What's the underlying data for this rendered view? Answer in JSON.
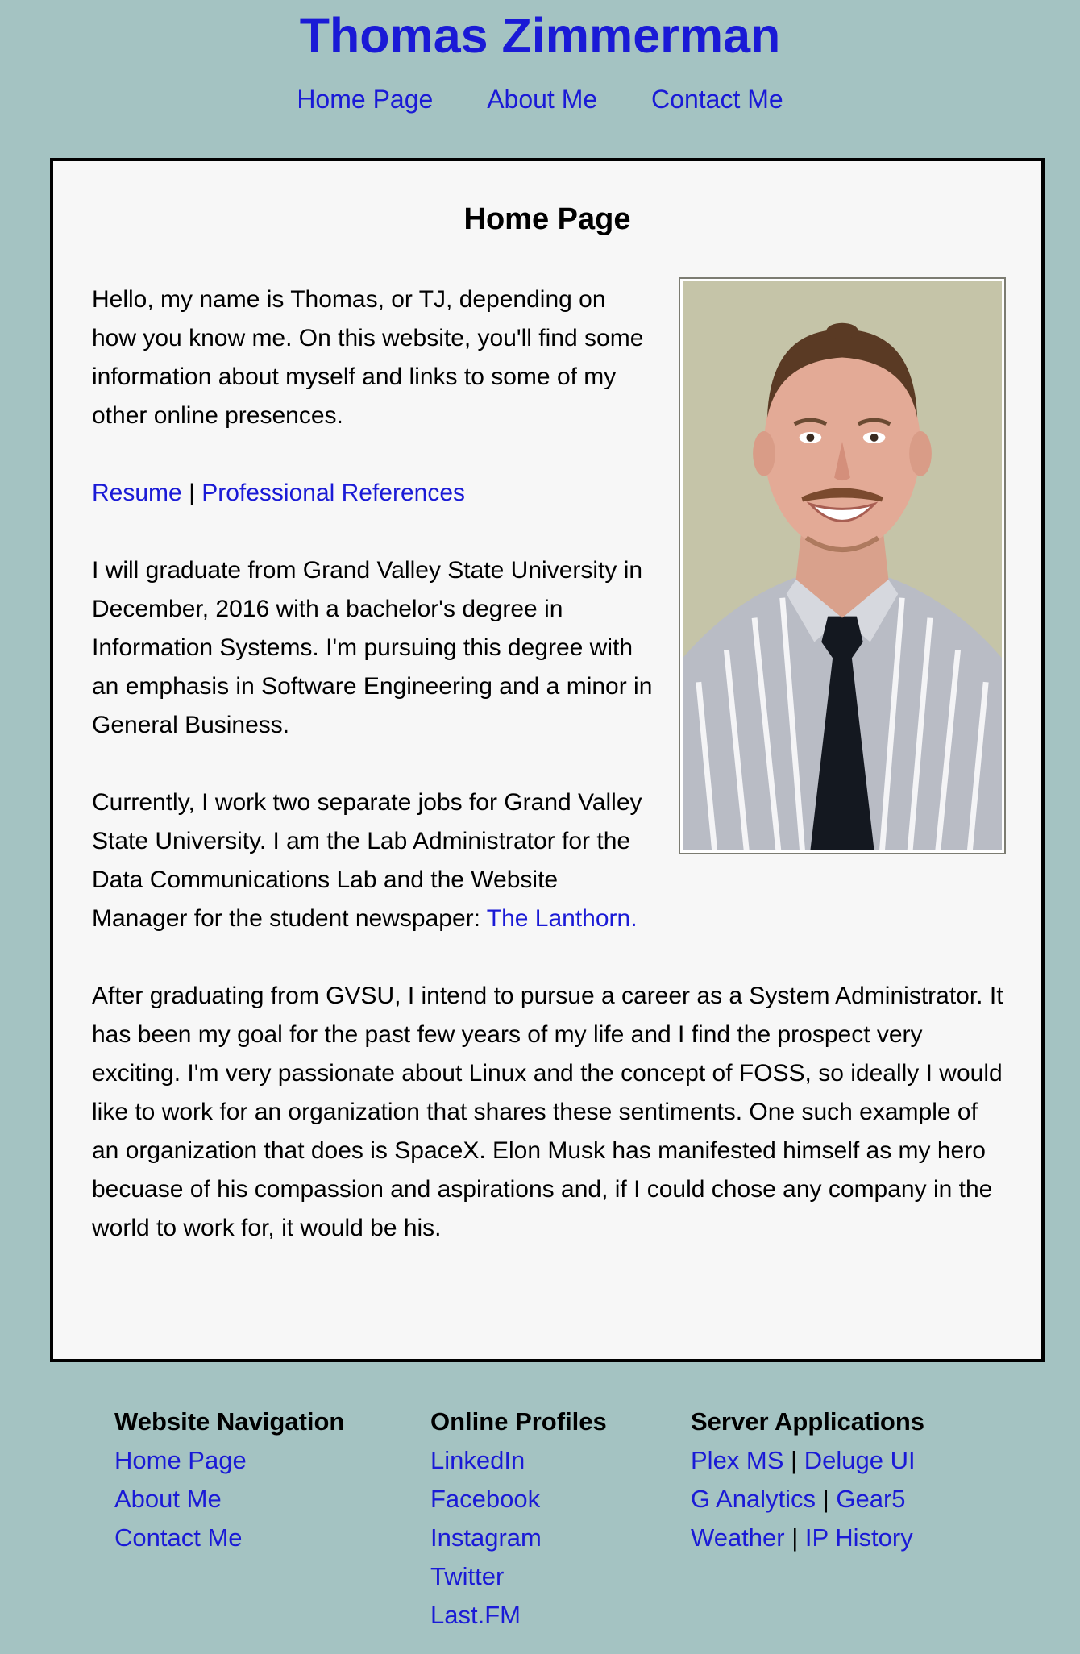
{
  "header": {
    "title": "Thomas Zimmerman",
    "nav": [
      "Home Page",
      "About Me",
      "Contact Me"
    ]
  },
  "main": {
    "heading": "Home Page",
    "intro": "Hello, my name is Thomas, or TJ, depending on how you know me. On this website, you'll find some information about myself and links to some of my other online presences.",
    "links": {
      "resume": "Resume",
      "separator": "|",
      "references": "Professional References"
    },
    "education": "I will graduate from Grand Valley State University in December, 2016 with a bachelor's degree in Information Systems. I'm pursuing this degree with an emphasis in Software Engineering and a minor in General Business.",
    "work": "Currently, I work two separate jobs for Grand Valley State University. I am the Lab Administrator for the Data Communications Lab and the Website Manager for the student newspaper:",
    "work_link": "The Lanthorn.",
    "career": "After graduating from GVSU, I intend to pursue a career as a System Administrator. It has been my goal for the past few years of my life and I find the prospect very exciting. I'm very passionate about Linux and the concept of FOSS, so ideally I would like to work for an organization that shares these sentiments. One such example of an organization that does is SpaceX. Elon Musk has manifested himself as my hero becuase of his compassion and aspirations and, if I could chose any company in the world to work for, it would be his."
  },
  "footer": {
    "navigation": {
      "title": "Website Navigation",
      "items": [
        "Home Page",
        "About Me",
        "Contact Me"
      ]
    },
    "profiles": {
      "title": "Online Profiles",
      "items": [
        "LinkedIn",
        "Facebook",
        "Instagram",
        "Twitter",
        "Last.FM"
      ]
    },
    "servers": {
      "title": "Server Applications",
      "separator": "|",
      "rows": [
        [
          "Plex MS",
          "Deluge UI"
        ],
        [
          "G Analytics",
          "Gear5"
        ],
        [
          "Weather",
          "IP History"
        ]
      ]
    }
  },
  "colors": {
    "background": "#a4c3c2",
    "content_background": "#f7f7f7",
    "link": "#1a1ad6",
    "border": "#000000"
  }
}
